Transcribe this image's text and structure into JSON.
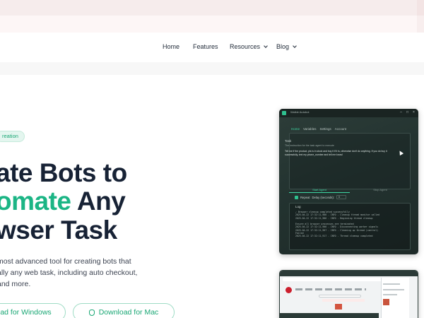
{
  "nav": {
    "items": [
      {
        "label": "Home"
      },
      {
        "label": "Features"
      },
      {
        "label": "Resources"
      },
      {
        "label": "Blog"
      }
    ]
  },
  "hero": {
    "pill": "reation",
    "line1": "ate Bots to",
    "line2_accent": "omate",
    "line2_rest": " Any",
    "line3": "wser Task",
    "desc_line1": "most advanced tool for creating bots that",
    "desc_line2": "ally any web task, including auto checkout,",
    "desc_line3": "and more.",
    "btn_windows": "ad for Windows",
    "btn_mac": "Download for Mac"
  },
  "app_window": {
    "title": "Walkie Autobot",
    "tabs": [
      "Home",
      "Variables",
      "Settings",
      "Account"
    ],
    "task_label": "Task",
    "task_hint": "The instruction for the task agent to execute",
    "task_text": "Tell me if the product, pls is in stock and buy it if it is, otherwise don't do anything. If you do buy it successfully, text my phone_number and tell me know!",
    "start_label": "Start Agent",
    "stop_label": "Stop Agent",
    "repeat_label": "Repeat",
    "delay_label": "Delay (seconds):",
    "delay_value": "0",
    "log_label": "Log",
    "log_lines": [
      "✓ Browser cleanup completed successfully",
      "2025-04-22 17:32:11,986 - INFO - Cleanup thread monitor called",
      "2025-04-22 17:32:11,986 - INFO - Beginning thread cleanup",
      "",
      "Ensure all browser processes are terminated",
      "2025-04-22 17:32:11,906 - INFO - Disconnecting worker signals",
      "2025-04-22 17:32:11,907 - INFO - Cleaning up thread (control)",
      "Failed",
      "2025-04-22 17:32:11,917 - INFO - Thread cleanup completed"
    ]
  },
  "colors": {
    "accent": "#1bb585",
    "headline": "#172235",
    "app_bg": "#233330"
  }
}
